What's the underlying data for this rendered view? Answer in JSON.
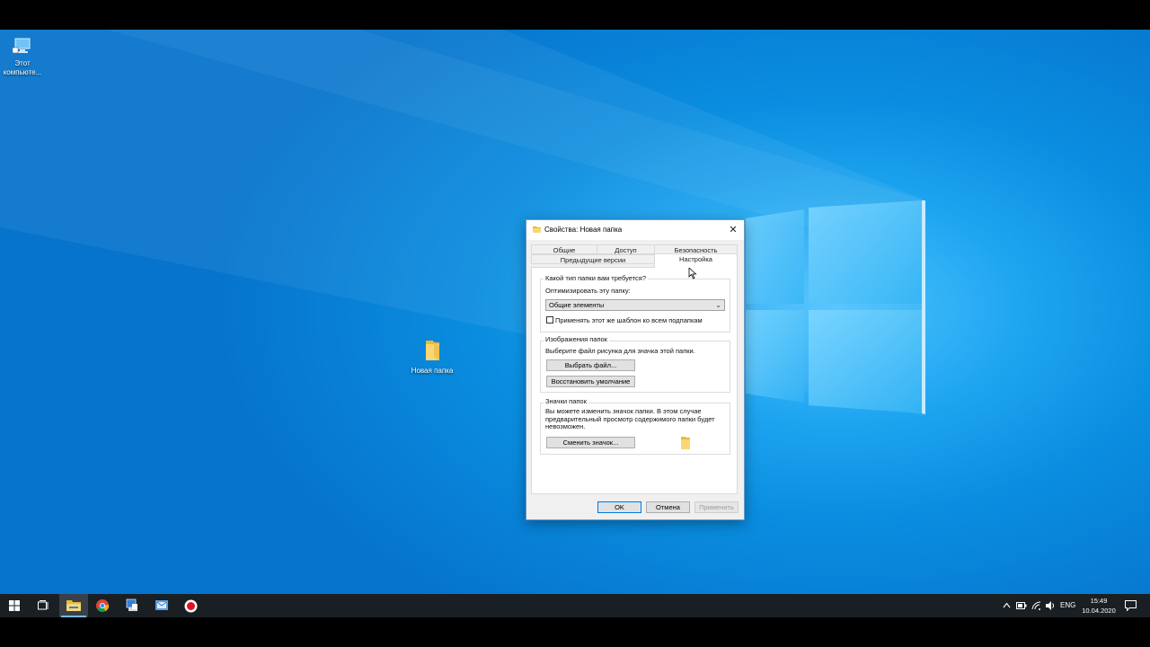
{
  "desktop": {
    "icons": [
      {
        "label_line1": "Этот",
        "label_line2": "компьюте..."
      },
      {
        "label_line1": "Новая папка"
      }
    ]
  },
  "dialog": {
    "title": "Свойства: Новая папка",
    "close_glyph": "✕",
    "tabs_row1": [
      "Общие",
      "Доступ",
      "Безопасность"
    ],
    "tabs_row2": [
      "Предыдущие версии",
      "Настройка"
    ],
    "active_tab": "Настройка",
    "section_type": {
      "legend": "Какой тип папки вам требуется?",
      "optimize_label": "Оптимизировать эту папку:",
      "select_value": "Общие элементы",
      "checkbox_label": "Применять этот же шаблон ко всем подпапкам",
      "checkbox_checked": false
    },
    "section_images": {
      "legend": "Изображения папок",
      "desc": "Выберите файл рисунка для значка этой папки.",
      "choose_button": "Выбрать файл...",
      "restore_button": "Восстановить умолчание"
    },
    "section_icons": {
      "legend": "Значки папок",
      "desc_line1": "Вы можете изменить значок папки. В этом случае",
      "desc_line2": "предварительный просмотр содержимого папки будет",
      "desc_line3": "невозможен.",
      "change_button": "Сменить значок..."
    },
    "buttons": {
      "ok": "OK",
      "cancel": "Отмена",
      "apply": "Применить"
    }
  },
  "taskbar": {
    "apps": [
      "start-icon",
      "task-view-icon",
      "file-explorer-icon",
      "chrome-icon",
      "app-icon",
      "mail-icon",
      "record-icon"
    ],
    "language": "ENG",
    "time": "15:49",
    "date": "10.04.2020"
  },
  "colors": {
    "accent": "#0078d7",
    "desktop_blue": "#0a8ee0",
    "taskbar": "#1a1f24"
  }
}
